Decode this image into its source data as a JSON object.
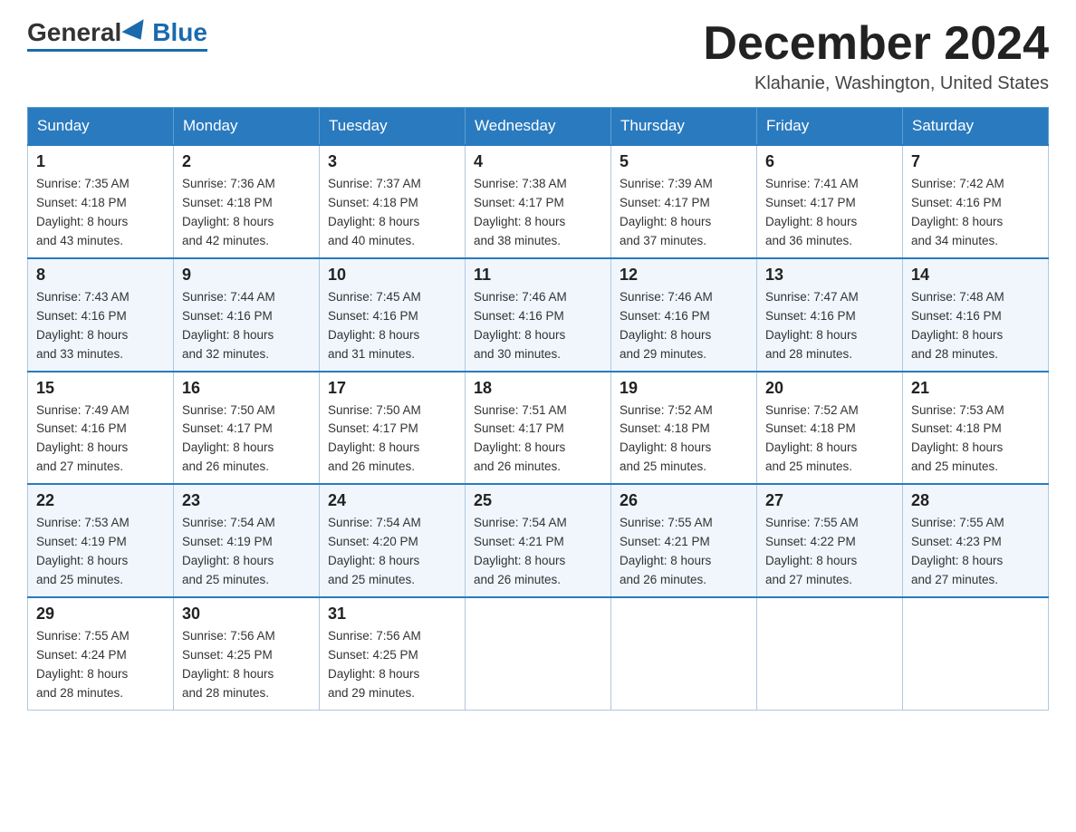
{
  "logo": {
    "general": "General",
    "blue": "Blue"
  },
  "header": {
    "month_year": "December 2024",
    "location": "Klahanie, Washington, United States"
  },
  "weekdays": [
    "Sunday",
    "Monday",
    "Tuesday",
    "Wednesday",
    "Thursday",
    "Friday",
    "Saturday"
  ],
  "weeks": [
    [
      {
        "day": "1",
        "sunrise": "7:35 AM",
        "sunset": "4:18 PM",
        "daylight": "8 hours and 43 minutes."
      },
      {
        "day": "2",
        "sunrise": "7:36 AM",
        "sunset": "4:18 PM",
        "daylight": "8 hours and 42 minutes."
      },
      {
        "day": "3",
        "sunrise": "7:37 AM",
        "sunset": "4:18 PM",
        "daylight": "8 hours and 40 minutes."
      },
      {
        "day": "4",
        "sunrise": "7:38 AM",
        "sunset": "4:17 PM",
        "daylight": "8 hours and 38 minutes."
      },
      {
        "day": "5",
        "sunrise": "7:39 AM",
        "sunset": "4:17 PM",
        "daylight": "8 hours and 37 minutes."
      },
      {
        "day": "6",
        "sunrise": "7:41 AM",
        "sunset": "4:17 PM",
        "daylight": "8 hours and 36 minutes."
      },
      {
        "day": "7",
        "sunrise": "7:42 AM",
        "sunset": "4:16 PM",
        "daylight": "8 hours and 34 minutes."
      }
    ],
    [
      {
        "day": "8",
        "sunrise": "7:43 AM",
        "sunset": "4:16 PM",
        "daylight": "8 hours and 33 minutes."
      },
      {
        "day": "9",
        "sunrise": "7:44 AM",
        "sunset": "4:16 PM",
        "daylight": "8 hours and 32 minutes."
      },
      {
        "day": "10",
        "sunrise": "7:45 AM",
        "sunset": "4:16 PM",
        "daylight": "8 hours and 31 minutes."
      },
      {
        "day": "11",
        "sunrise": "7:46 AM",
        "sunset": "4:16 PM",
        "daylight": "8 hours and 30 minutes."
      },
      {
        "day": "12",
        "sunrise": "7:46 AM",
        "sunset": "4:16 PM",
        "daylight": "8 hours and 29 minutes."
      },
      {
        "day": "13",
        "sunrise": "7:47 AM",
        "sunset": "4:16 PM",
        "daylight": "8 hours and 28 minutes."
      },
      {
        "day": "14",
        "sunrise": "7:48 AM",
        "sunset": "4:16 PM",
        "daylight": "8 hours and 28 minutes."
      }
    ],
    [
      {
        "day": "15",
        "sunrise": "7:49 AM",
        "sunset": "4:16 PM",
        "daylight": "8 hours and 27 minutes."
      },
      {
        "day": "16",
        "sunrise": "7:50 AM",
        "sunset": "4:17 PM",
        "daylight": "8 hours and 26 minutes."
      },
      {
        "day": "17",
        "sunrise": "7:50 AM",
        "sunset": "4:17 PM",
        "daylight": "8 hours and 26 minutes."
      },
      {
        "day": "18",
        "sunrise": "7:51 AM",
        "sunset": "4:17 PM",
        "daylight": "8 hours and 26 minutes."
      },
      {
        "day": "19",
        "sunrise": "7:52 AM",
        "sunset": "4:18 PM",
        "daylight": "8 hours and 25 minutes."
      },
      {
        "day": "20",
        "sunrise": "7:52 AM",
        "sunset": "4:18 PM",
        "daylight": "8 hours and 25 minutes."
      },
      {
        "day": "21",
        "sunrise": "7:53 AM",
        "sunset": "4:18 PM",
        "daylight": "8 hours and 25 minutes."
      }
    ],
    [
      {
        "day": "22",
        "sunrise": "7:53 AM",
        "sunset": "4:19 PM",
        "daylight": "8 hours and 25 minutes."
      },
      {
        "day": "23",
        "sunrise": "7:54 AM",
        "sunset": "4:19 PM",
        "daylight": "8 hours and 25 minutes."
      },
      {
        "day": "24",
        "sunrise": "7:54 AM",
        "sunset": "4:20 PM",
        "daylight": "8 hours and 25 minutes."
      },
      {
        "day": "25",
        "sunrise": "7:54 AM",
        "sunset": "4:21 PM",
        "daylight": "8 hours and 26 minutes."
      },
      {
        "day": "26",
        "sunrise": "7:55 AM",
        "sunset": "4:21 PM",
        "daylight": "8 hours and 26 minutes."
      },
      {
        "day": "27",
        "sunrise": "7:55 AM",
        "sunset": "4:22 PM",
        "daylight": "8 hours and 27 minutes."
      },
      {
        "day": "28",
        "sunrise": "7:55 AM",
        "sunset": "4:23 PM",
        "daylight": "8 hours and 27 minutes."
      }
    ],
    [
      {
        "day": "29",
        "sunrise": "7:55 AM",
        "sunset": "4:24 PM",
        "daylight": "8 hours and 28 minutes."
      },
      {
        "day": "30",
        "sunrise": "7:56 AM",
        "sunset": "4:25 PM",
        "daylight": "8 hours and 28 minutes."
      },
      {
        "day": "31",
        "sunrise": "7:56 AM",
        "sunset": "4:25 PM",
        "daylight": "8 hours and 29 minutes."
      },
      null,
      null,
      null,
      null
    ]
  ],
  "labels": {
    "sunrise": "Sunrise:",
    "sunset": "Sunset:",
    "daylight": "Daylight:"
  }
}
